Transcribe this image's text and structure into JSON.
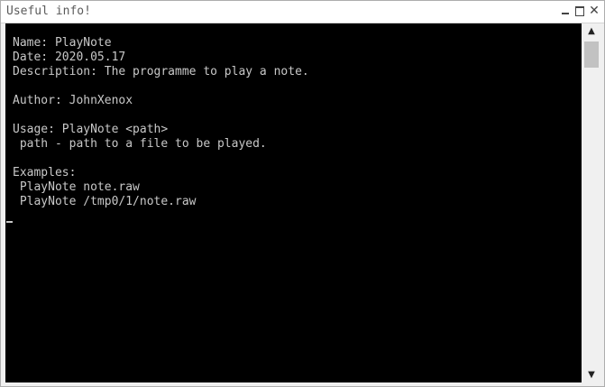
{
  "window": {
    "title": "Useful info!"
  },
  "console": {
    "lines": [
      "Name: PlayNote",
      "Date: 2020.05.17",
      "Description: The programme to play a note.",
      "",
      "Author: JohnXenox",
      "",
      "Usage: PlayNote <path>",
      " path - path to a file to be played.",
      "",
      "Examples:",
      " PlayNote note.raw",
      " PlayNote /tmp0/1/note.raw"
    ]
  },
  "icons": {
    "minimize": "minimize-icon",
    "maximize": "maximize-icon",
    "close": "close-icon",
    "scroll_up": "arrow-up-icon",
    "scroll_down": "arrow-down-icon"
  },
  "colors": {
    "console_bg": "#000000",
    "console_fg": "#c8c8c8",
    "titlebar_bg": "#ffffff",
    "title_fg": "#5a5a5a"
  }
}
